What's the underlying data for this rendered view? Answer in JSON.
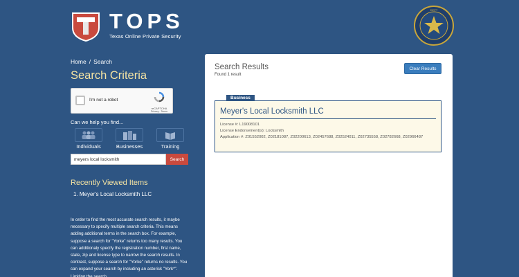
{
  "header": {
    "logo_title": "TOPS",
    "logo_subtitle": "Texas Online Private Security",
    "seal": "department-of-public-safety-seal"
  },
  "breadcrumb": {
    "home": "Home",
    "separator": "/",
    "current": "Search"
  },
  "page_title": "Search Criteria",
  "captcha": {
    "label": "I'm not a robot",
    "brand": "reCAPTCHA",
    "links": "Privacy - Terms"
  },
  "help": {
    "prompt": "Can we help you find...",
    "options": [
      {
        "label": "Individuals",
        "icon": "people-icon"
      },
      {
        "label": "Businesses",
        "icon": "buildings-icon"
      },
      {
        "label": "Training",
        "icon": "training-icon"
      }
    ]
  },
  "search": {
    "value": "meyers local locksmith",
    "button": "Search"
  },
  "recent": {
    "title": "Recently Viewed Items",
    "items": [
      "1. Meyer's Local Locksmith LLC"
    ]
  },
  "info_text": "In order to find the most accurate search results, it maybe necessary to specify multiple search criteria. This means adding additional terms in the search box. For example, suppose a search for \"Yorke\" returns too many results. You can additionaly specify the registration number, first name, state, zip and license type to narrow the search results. In contrast, suppose a search for \"Yorke\" returns no results. You can expand your search by including an asterisk \"York*\". Limiting the search",
  "results": {
    "title": "Search Results",
    "count": "Found 1 result",
    "clear_button": "Clear Results",
    "items": [
      {
        "badge": "Business",
        "name": "Meyer's Local Locksmith LLC",
        "license": "License #: L19008101",
        "endorsement": "License Endorsement(s): Locksmith",
        "applications": "Application #: Z01552002, Z02181087, Z02200613, Z02457688, Z02524011, Z02735558, Z02782668, Z02966487"
      }
    ]
  },
  "colors": {
    "background": "#2e5583",
    "accent_title": "#f4e3a3",
    "search_button": "#c94a3e",
    "clear_button": "#3a7dbd",
    "card_bg": "#fdf9e8"
  }
}
